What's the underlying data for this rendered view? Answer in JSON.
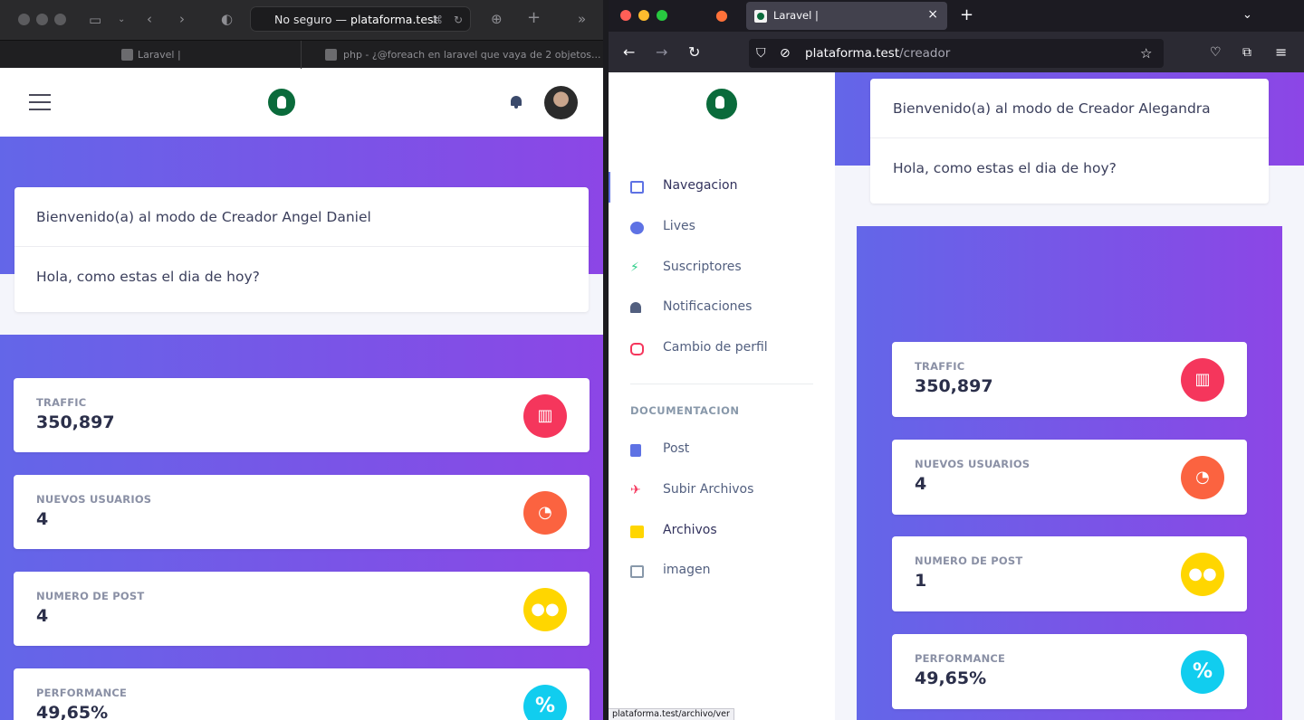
{
  "left_window": {
    "address_bar": {
      "prefix": "No seguro —",
      "host": "plataforma.test"
    },
    "tabs": [
      {
        "label": "Laravel |"
      },
      {
        "label": "php - ¿@foreach en laravel que vaya de 2 objetos..."
      }
    ],
    "welcome_card": {
      "title": "Bienvenido(a) al modo de Creador Angel Daniel",
      "body": "Hola, como estas el dia de hoy?"
    },
    "stats": [
      {
        "label": "TRAFFIC",
        "value": "350,897",
        "icon": "bar-chart-icon",
        "color": "#f5365c"
      },
      {
        "label": "NUEVOS USUARIOS",
        "value": "4",
        "icon": "pie-chart-icon",
        "color": "#fb6340"
      },
      {
        "label": "NUMERO DE POST",
        "value": "4",
        "icon": "users-icon",
        "color": "#ffd600"
      },
      {
        "label": "PERFORMANCE",
        "value": "49,65%",
        "icon": "percent-icon",
        "color": "#11cdef"
      }
    ]
  },
  "right_window": {
    "tab_title": "Laravel |",
    "url": {
      "host": "plataforma.test",
      "path": "/creador"
    },
    "sidebar": {
      "items": [
        {
          "label": "Navegacion",
          "icon": "monitor-icon",
          "color": "#5e72e4"
        },
        {
          "label": "Lives",
          "icon": "globe-icon",
          "color": "#5e72e4"
        },
        {
          "label": "Suscriptores",
          "icon": "runner-icon",
          "color": "#2dce89"
        },
        {
          "label": "Notificaciones",
          "icon": "bell-icon",
          "color": "#525f7f"
        },
        {
          "label": "Cambio de perfil",
          "icon": "switch-icon",
          "color": "#f5365c"
        }
      ],
      "section_title": "DOCUMENTACION",
      "doc_items": [
        {
          "label": "Post",
          "icon": "document-icon",
          "color": "#5e72e4"
        },
        {
          "label": "Subir Archivos",
          "icon": "rocket-icon",
          "color": "#f5365c"
        },
        {
          "label": "Archivos",
          "icon": "folder-icon",
          "color": "#ffd600"
        },
        {
          "label": "imagen",
          "icon": "image-icon",
          "color": "#8898aa"
        }
      ]
    },
    "welcome_card": {
      "title": "Bienvenido(a) al modo de Creador Alegandra",
      "body": "Hola, como estas el dia de hoy?"
    },
    "stats": [
      {
        "label": "TRAFFIC",
        "value": "350,897",
        "icon": "bar-chart-icon",
        "color": "#f5365c"
      },
      {
        "label": "NUEVOS USUARIOS",
        "value": "4",
        "icon": "pie-chart-icon",
        "color": "#fb6340"
      },
      {
        "label": "NUMERO DE POST",
        "value": "1",
        "icon": "users-icon",
        "color": "#ffd600"
      },
      {
        "label": "PERFORMANCE",
        "value": "49,65%",
        "icon": "percent-icon",
        "color": "#11cdef"
      }
    ],
    "status_bar": "plataforma.test/archivo/ver"
  }
}
